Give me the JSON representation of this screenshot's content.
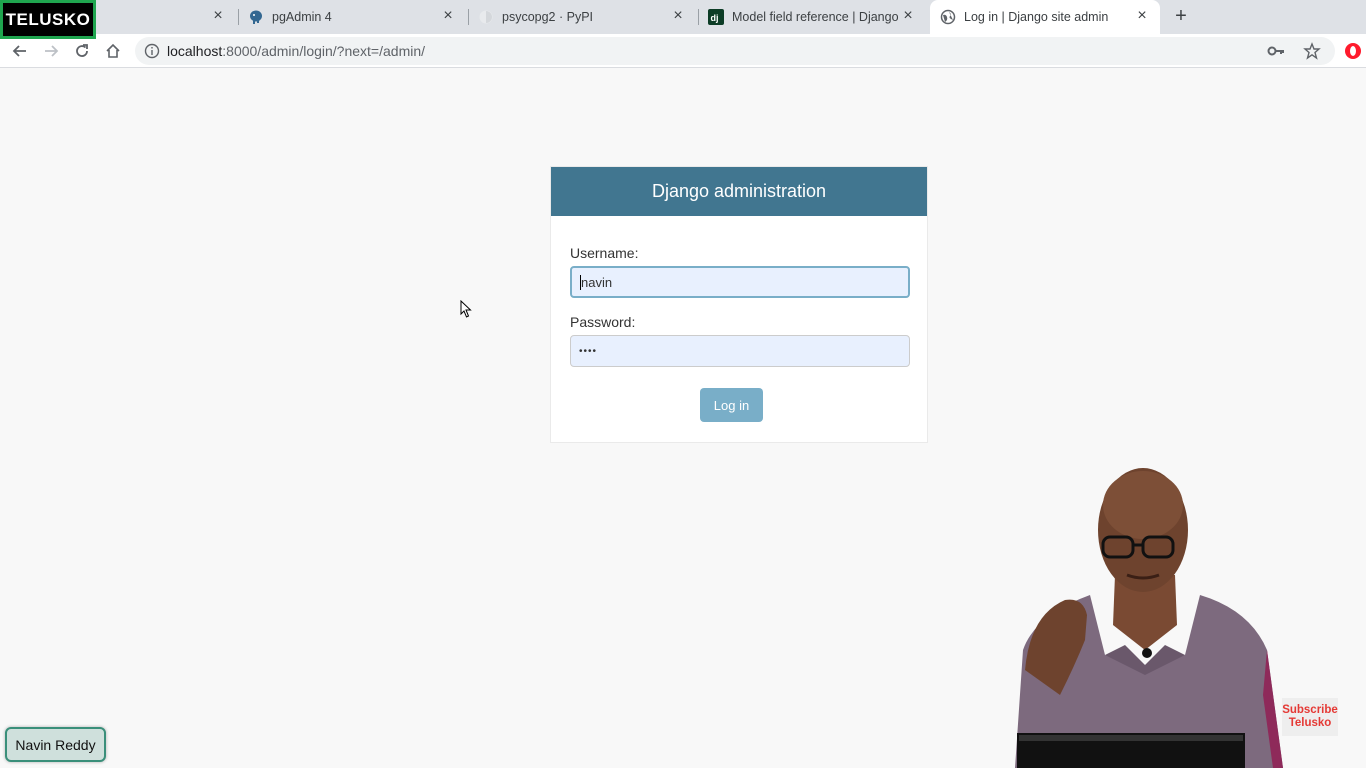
{
  "brand": {
    "logo_text": "TELUSKO"
  },
  "tabs": [
    {
      "label": "",
      "favicon": "none",
      "active": false
    },
    {
      "label": "pgAdmin 4",
      "favicon": "elephant-icon",
      "active": false
    },
    {
      "label": "psycopg2 · PyPI",
      "favicon": "pypi-icon",
      "active": false
    },
    {
      "label": "Model field reference | Django d",
      "favicon": "django-icon",
      "active": false
    },
    {
      "label": "Log in | Django site admin",
      "favicon": "globe-icon",
      "active": true
    }
  ],
  "address_bar": {
    "host": "localhost",
    "path": ":8000/admin/login/?next=/admin/"
  },
  "login": {
    "header": "Django administration",
    "username_label": "Username:",
    "username_value": "navin",
    "password_label": "Password:",
    "password_value": "••••",
    "submit_label": "Log in"
  },
  "overlay": {
    "presenter_name": "Navin Reddy",
    "subscribe_line1": "Subscribe",
    "subscribe_line2": "Telusko"
  },
  "colors": {
    "django_header": "#417690",
    "login_button": "#79aec8",
    "autofill_bg": "#e8f0fe",
    "subscribe_text": "#e53935"
  }
}
